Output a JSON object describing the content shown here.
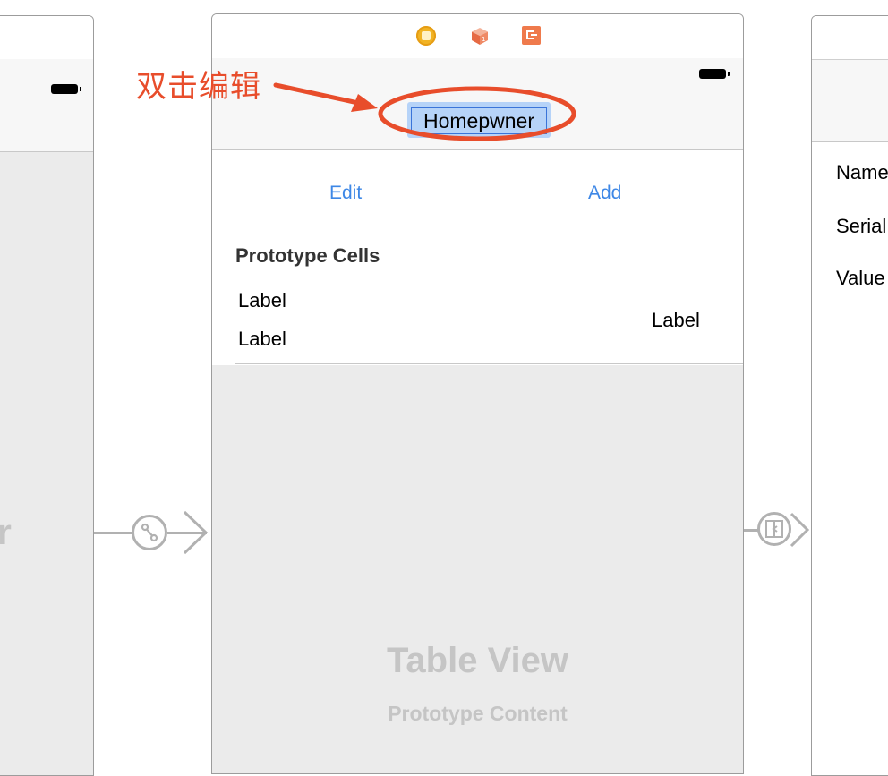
{
  "annotation": {
    "label": "双击编辑",
    "color": "#e84d2b"
  },
  "left_scene": {
    "ghost_title": "er"
  },
  "center_scene": {
    "dock_icons": [
      "view-controller-icon",
      "first-responder-cube-icon",
      "exit-icon"
    ],
    "nav_title": "Homepwner",
    "bar_buttons": {
      "edit": "Edit",
      "add": "Add"
    },
    "section_header": "Prototype Cells",
    "prototype_cell": {
      "title_label": "Label",
      "subtitle_label": "Label",
      "right_label": "Label"
    },
    "table_view_title": "Table View",
    "table_view_subtitle": "Prototype Content"
  },
  "right_scene": {
    "labels": [
      "Name",
      "Serial",
      "Value"
    ]
  },
  "colors": {
    "accent_blue": "#3d87e6",
    "selection": "#b6d3f8",
    "placeholder_gray": "#c5c5c5",
    "segue_gray": "#b1b1b1"
  }
}
